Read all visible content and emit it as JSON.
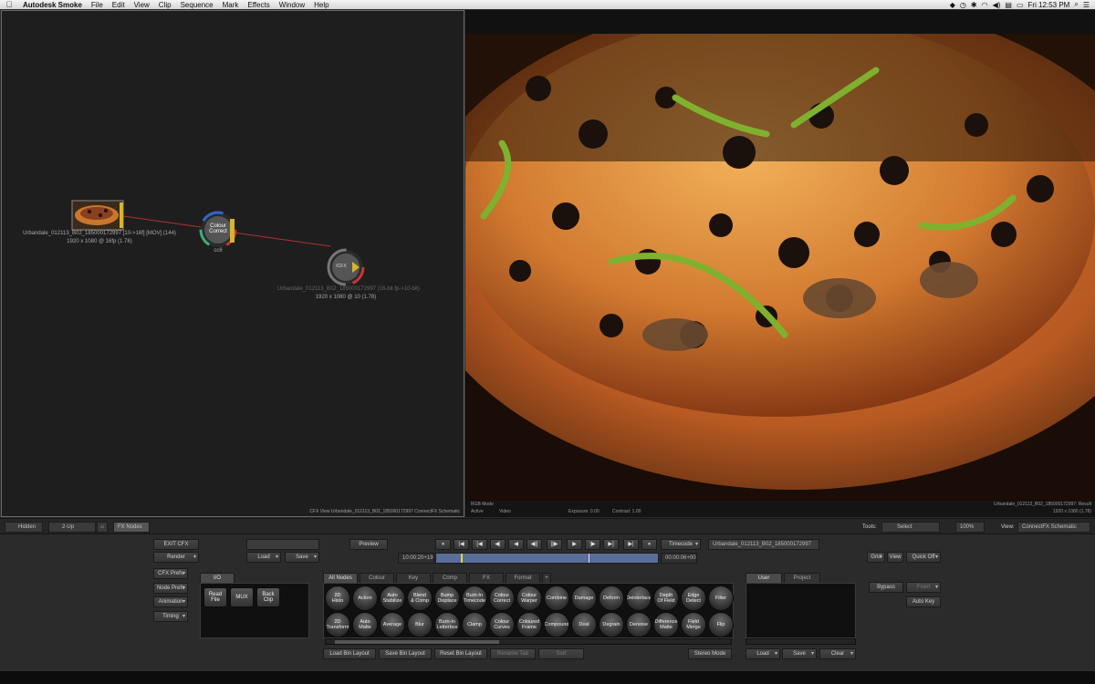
{
  "menubar": {
    "app": "Autodesk Smoke",
    "items": [
      "File",
      "Edit",
      "View",
      "Clip",
      "Sequence",
      "Mark",
      "Effects",
      "Window",
      "Help"
    ],
    "clock": "Fri 12:53 PM"
  },
  "schematic": {
    "source_node": {
      "label": "Urbandale_012113_B02_185000172997 [10->16f] [MOV] (144)",
      "format": "1920 x 1080 @ 16fp (1.78)"
    },
    "cc_node": {
      "text": "Colour\nCorrect",
      "name": "cc6"
    },
    "output_node": {
      "text": "ICFX",
      "label": "Urbandale_012113_B02_185000172997 (16-bit fp->10-bit)",
      "format": "1920 x 1080 @ 10 (1.78)"
    },
    "footer": "CFX View Urbandale_012113_B02_185000172997 ConnectFX Schematic"
  },
  "viewer": {
    "mode_label": "RGB Mode",
    "active_label": "Active",
    "video_label": "Video",
    "exposure": "Exposure: 0.00",
    "contrast": "Contrast: 1.00",
    "result_title": "Urbandale_012113_B02_185000172997: Result",
    "result_format": "1920 x 1080 (1.78)"
  },
  "toolbar": {
    "hidden": "Hidden",
    "layout": "2-Up",
    "fx_nodes": "FX Nodes",
    "tools_label": "Tools:",
    "tools_value": "Select",
    "zoom": "100%",
    "view_label": "View:",
    "view_value": "ConnectFX Schematic"
  },
  "controls": {
    "exit_cfx": "EXIT CFX",
    "render": "Render",
    "load": "Load",
    "save": "Save",
    "preview": "Preview",
    "timecode_mode": "Timecode",
    "clip_name": "Urbandale_012113_B02_185000172997",
    "timecode_in": "10:00:20+19",
    "timecode_out": "00:00:06+00",
    "grid": "Grid",
    "view": "View",
    "quick_off": "Quick Off",
    "side_buttons": [
      "CFX Prefs",
      "Node Prefs",
      "Animation",
      "Timing"
    ],
    "transport": [
      "⏸",
      "|◀",
      "[◀",
      "◀|",
      "◀",
      "◀||",
      "||▶",
      "▶",
      "|▶",
      "▶]",
      "▶|",
      "⏸"
    ]
  },
  "io_panel": {
    "tab": "I/O",
    "buttons": [
      "Read\nFile",
      "MUX",
      "Back\nClip"
    ]
  },
  "node_bin": {
    "tabs": [
      "All Nodes",
      "Colour",
      "Key",
      "Comp",
      "FX",
      "Format",
      "+"
    ],
    "row1": [
      "2D\nHisto",
      "Action",
      "Auto\nStabilize",
      "Blend\n& Comp",
      "Bump\nDisplace",
      "Burn-In\nTimecode",
      "Colour\nCorrect",
      "Colour\nWarper",
      "Combine",
      "Damage",
      "Deform",
      "Deinterlace",
      "Depth\nOf Field",
      "Edge\nDetect",
      "Filter"
    ],
    "row2": [
      "2D\nTransform",
      "Auto\nMatte",
      "Average",
      "Blur",
      "Burn-In\nLetterbox",
      "Clamp",
      "Colour\nCurves",
      "Coloured\nFrame",
      "Compound",
      "Deal",
      "Degrain",
      "Denoise",
      "Difference\nMatte",
      "Field\nMerge",
      "Flip"
    ],
    "bottom_buttons": [
      "Load Bin Layout",
      "Save Bin Layout",
      "Reset Bin Layout",
      "Rename Tab",
      "Sort"
    ],
    "stereo_mode": "Stereo Mode"
  },
  "user_panel": {
    "tabs": [
      "User",
      "Project"
    ],
    "buttons": [
      "Load",
      "Save",
      "Clear"
    ]
  },
  "right_panel": {
    "bypass": "Bypass",
    "front": "Front",
    "auto_key": "Auto Key"
  }
}
